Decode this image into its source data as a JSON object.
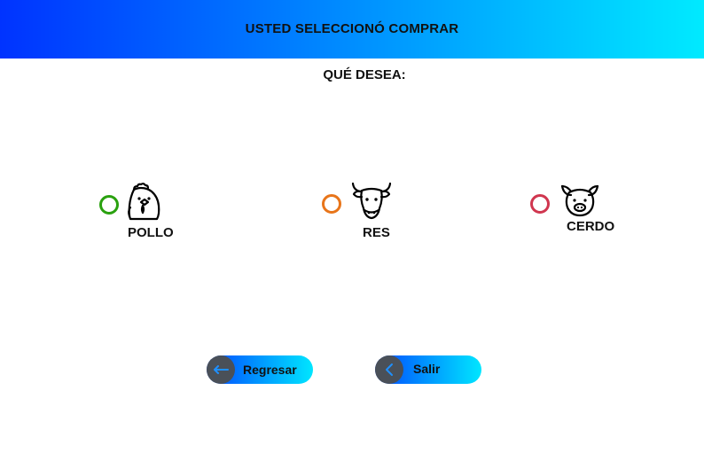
{
  "header": {
    "title": "USTED SELECCIONÓ COMPRAR"
  },
  "prompt": "QUÉ DESEA:",
  "options": [
    {
      "label": "POLLO",
      "icon": "chicken-icon",
      "radio_color": "#2aa10f"
    },
    {
      "label": "RES",
      "icon": "bull-icon",
      "radio_color": "#e8751a"
    },
    {
      "label": "CERDO",
      "icon": "pig-icon",
      "radio_color": "#d0364f"
    }
  ],
  "buttons": {
    "back": {
      "label": "Regresar",
      "icon": "arrow-left-icon"
    },
    "exit": {
      "label": "Salir",
      "icon": "chevron-left-icon"
    }
  },
  "colors": {
    "header_gradient_start": "#0033ff",
    "header_gradient_end": "#00eaff",
    "button_icon_bg": "#4a5058",
    "button_icon_accent": "#1e90ff"
  }
}
